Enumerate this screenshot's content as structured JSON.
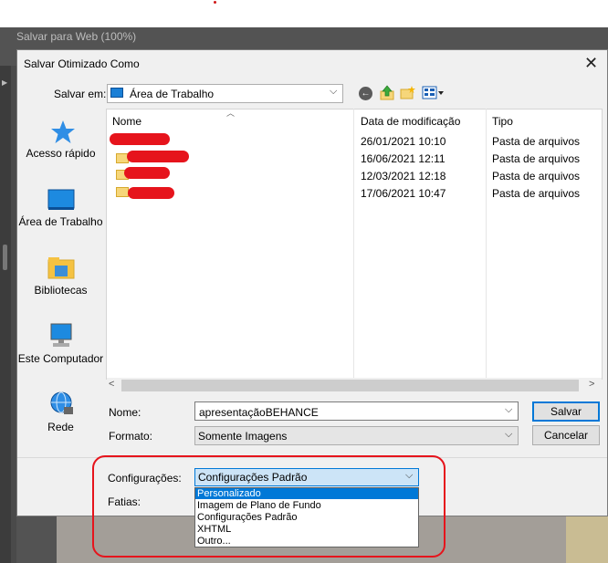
{
  "background": {
    "title": "Salvar para Web (100%)"
  },
  "dialog": {
    "title": "Salvar Otimizado Como",
    "close_glyph": "✕",
    "save_in_label": "Salvar em:",
    "save_in_value": "Área de Trabalho",
    "toolbar": {
      "back_icon": "back-arrow-icon",
      "up_icon": "up-folder-icon",
      "new_folder_icon": "new-folder-icon",
      "view_icon": "view-menu-icon"
    },
    "sidebar": [
      {
        "label": "Acesso rápido",
        "icon": "quick-access-star-icon"
      },
      {
        "label": "Área de Trabalho",
        "icon": "desktop-icon"
      },
      {
        "label": "Bibliotecas",
        "icon": "libraries-icon"
      },
      {
        "label": "Este Computador",
        "icon": "computer-icon"
      },
      {
        "label": "Rede",
        "icon": "network-icon"
      }
    ],
    "columns": {
      "name": "Nome",
      "date": "Data de modificação",
      "type": "Tipo"
    },
    "files": [
      {
        "date": "26/01/2021 10:10",
        "type": "Pasta de arquivos"
      },
      {
        "date": "16/06/2021 12:11",
        "type": "Pasta de arquivos"
      },
      {
        "date": "12/03/2021 12:18",
        "type": "Pasta de arquivos"
      },
      {
        "date": "17/06/2021 10:47",
        "type": "Pasta de arquivos"
      }
    ],
    "name_label": "Nome:",
    "name_value": "apresentaçãoBEHANCE",
    "format_label": "Formato:",
    "format_value": "Somente Imagens",
    "save_button": "Salvar",
    "cancel_button": "Cancelar",
    "settings_label": "Configurações:",
    "settings_value": "Configurações Padrão",
    "slices_label": "Fatias:",
    "settings_options": [
      "Personalizado",
      "Imagem de Plano de Fundo",
      "Configurações Padrão",
      "XHTML",
      "Outro..."
    ]
  },
  "colors": {
    "accent": "#0078d7",
    "annotation": "#e6141c",
    "folder": "#f6d67a"
  }
}
